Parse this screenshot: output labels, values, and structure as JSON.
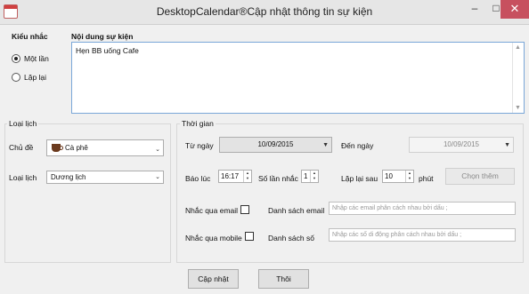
{
  "window": {
    "title": "DesktopCalendar®Cập nhật thông tin sự kiện",
    "min": "–",
    "max": "□",
    "close": "✕"
  },
  "reminder": {
    "heading": "Kiểu nhắc",
    "options": [
      {
        "label": "Một lần",
        "selected": true
      },
      {
        "label": "Lặp lại",
        "selected": false
      }
    ]
  },
  "content": {
    "heading": "Nội dung sự kiện",
    "value": "Hẹn BB uống Cafe"
  },
  "calendar_group": {
    "title": "Loại lịch",
    "topic_label": "Chủ đề",
    "topic_value": "Cà phê",
    "topic_icon": "coffee-cup-icon",
    "type_label": "Loại lịch",
    "type_value": "Dương lịch"
  },
  "time_group": {
    "title": "Thời gian",
    "from_label": "Từ ngày",
    "from_value": "10/09/2015",
    "to_label": "Đến ngày",
    "to_value": "10/09/2015",
    "at_label": "Báo lúc",
    "at_value": "16:17",
    "count_label": "Số lần nhắc",
    "count_value": "1",
    "repeat_label": "Lặp lại sau",
    "repeat_value": "10",
    "repeat_unit": "phút",
    "choose_more": "Chọn thêm",
    "email_check_label": "Nhắc qua email",
    "email_list_label": "Danh sách email",
    "email_placeholder": "Nhập các email phân cách nhau bởi dấu ;",
    "mobile_check_label": "Nhắc qua mobile",
    "phone_list_label": "Danh sách số",
    "phone_placeholder": "Nhập các số di động phân cách nhau bởi dấu ;"
  },
  "actions": {
    "update": "Cập nhật",
    "close": "Thôi"
  }
}
